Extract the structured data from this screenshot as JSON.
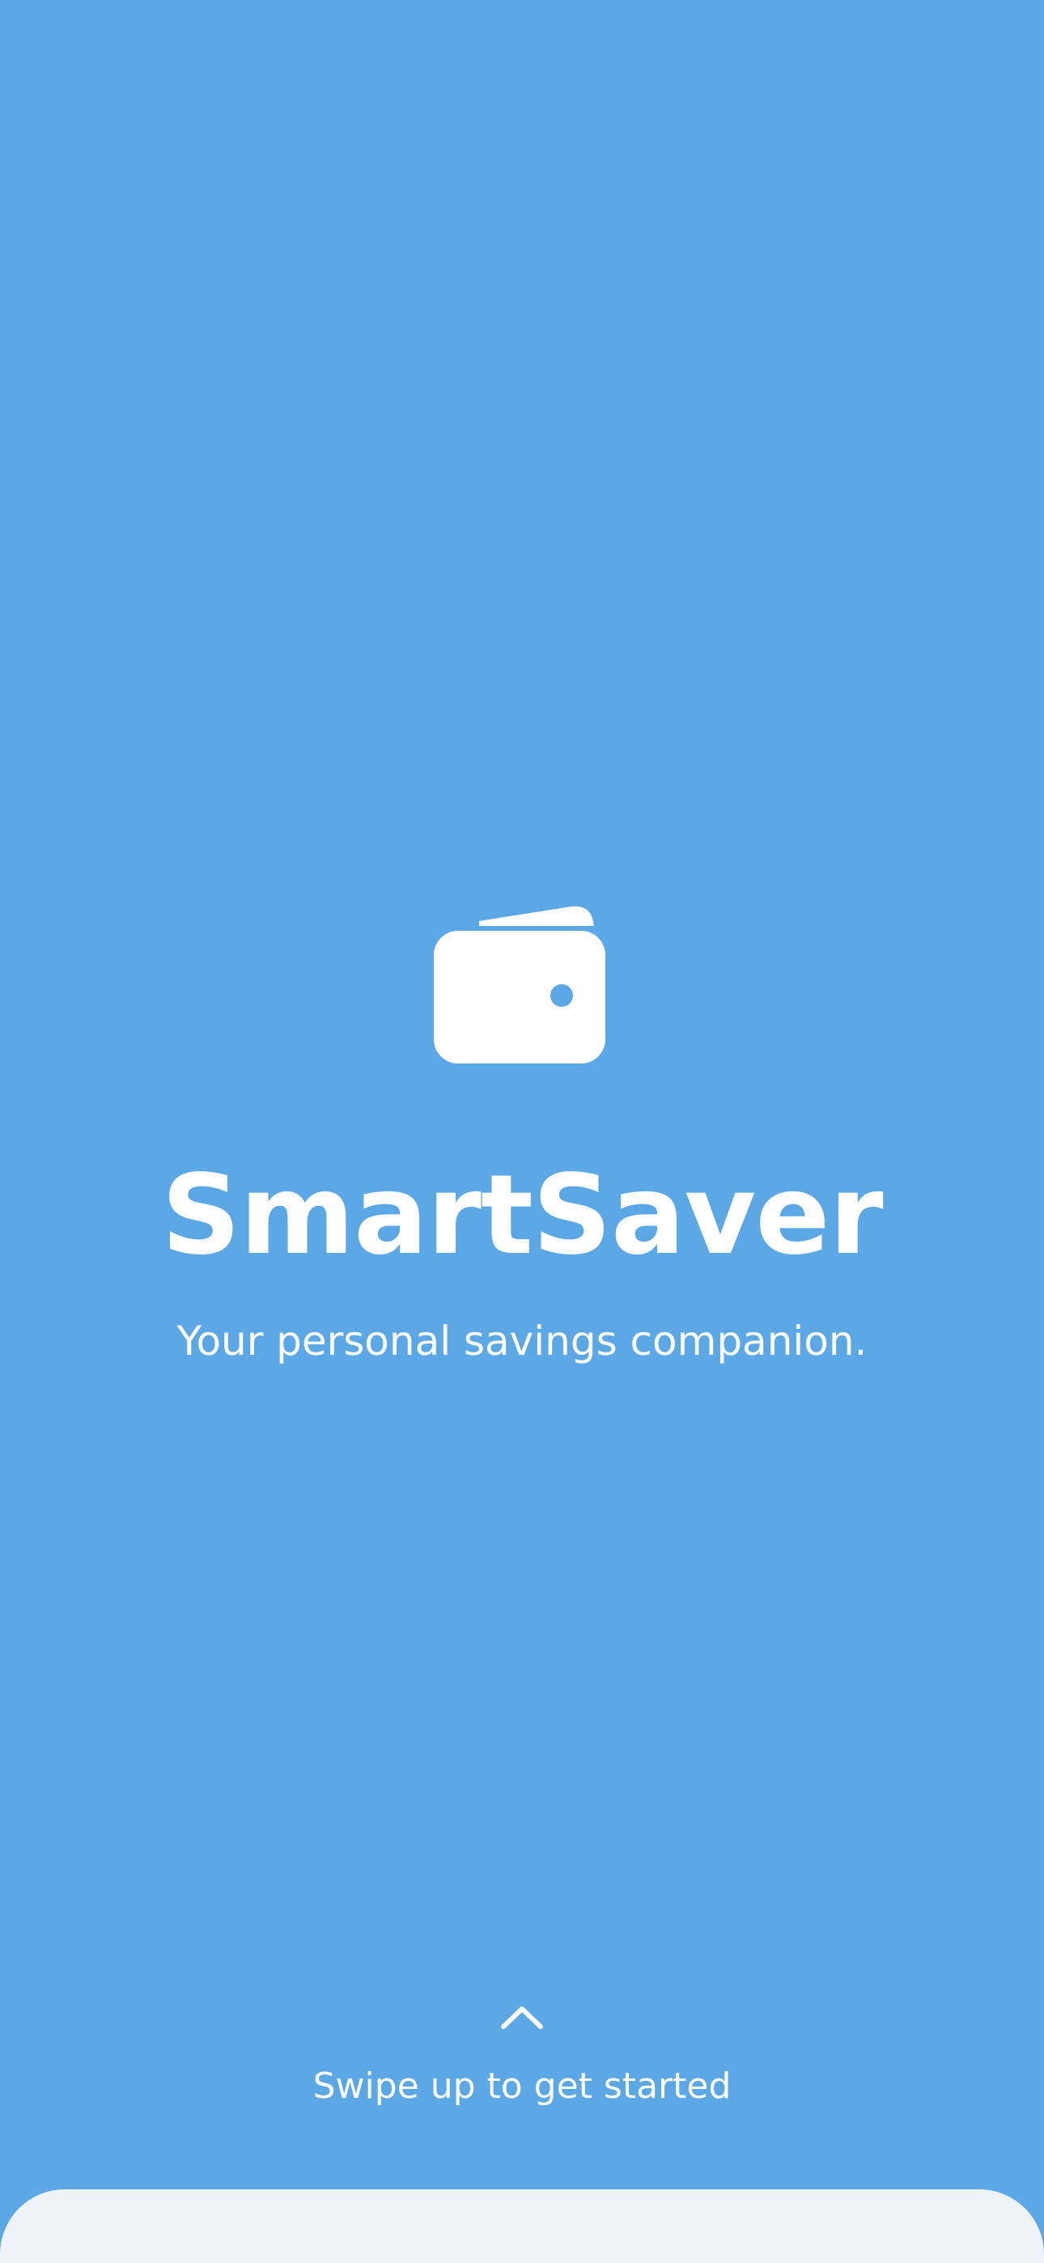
{
  "app": {
    "title": "SmartSaver",
    "subtitle": "Your personal savings companion.",
    "logo_icon": "wallet-icon"
  },
  "onboarding": {
    "swipe_hint": "Swipe up to get started",
    "swipe_icon": "chevron-up-icon"
  },
  "colors": {
    "background": "#5CA7E6",
    "foreground": "#FFFFFF",
    "sheet": "#EEF3F8"
  }
}
